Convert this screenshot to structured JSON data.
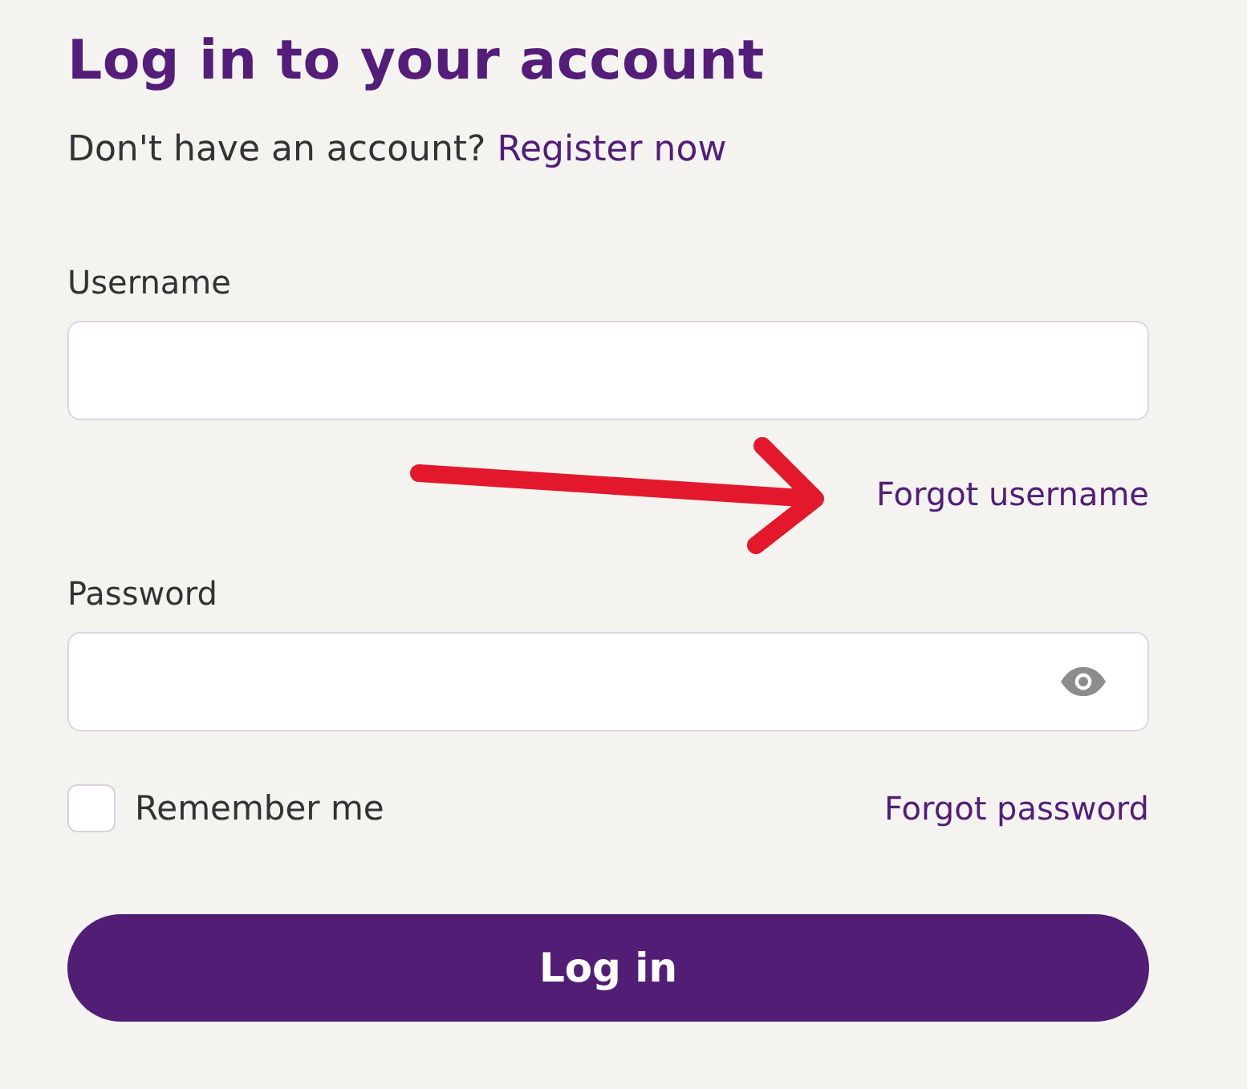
{
  "title": "Log in to your account",
  "register_prompt": {
    "text": "Don't have an account?",
    "link": "Register now"
  },
  "fields": [
    {
      "kind": "text",
      "label": "Username",
      "link": "Forgot username"
    },
    {
      "kind": "password",
      "label": "Password"
    }
  ],
  "annotation": {
    "kind": "arrow"
  },
  "remember_me": {
    "label": "Remember me",
    "checked": false
  },
  "forgot_password": "Forgot password",
  "submit_button": "Log in"
}
